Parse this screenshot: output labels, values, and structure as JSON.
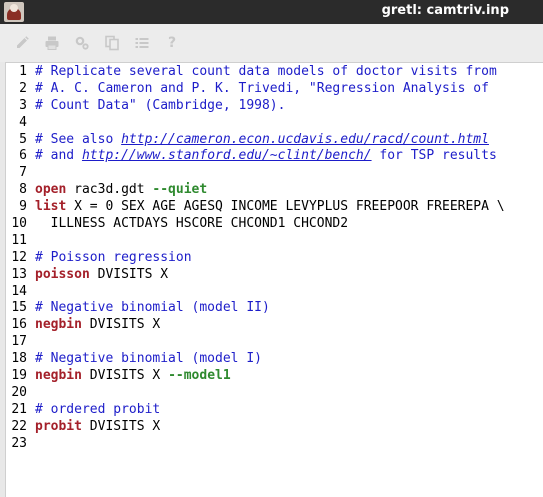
{
  "window": {
    "title": "gretl: camtriv.inp"
  },
  "toolbar": {
    "buttons": [
      {
        "name": "edit-icon"
      },
      {
        "name": "print-icon"
      },
      {
        "name": "settings-icon"
      },
      {
        "name": "copy-icon"
      },
      {
        "name": "list-icon"
      },
      {
        "name": "help-icon",
        "glyph": "?"
      }
    ],
    "icon_color": "#c8c8c8"
  },
  "editor": {
    "colors": {
      "comment": "#1d1dc9",
      "keyword": "#a4202a",
      "option": "#2f8a2f",
      "text": "#000000"
    },
    "lines": [
      {
        "num": "1",
        "seg": [
          {
            "t": "# Replicate several count data models of doctor visits from",
            "c": "cmt"
          }
        ]
      },
      {
        "num": "2",
        "seg": [
          {
            "t": "# A. C. Cameron and P. K. Trivedi, \"Regression Analysis of",
            "c": "cmt"
          }
        ]
      },
      {
        "num": "3",
        "seg": [
          {
            "t": "# Count Data\" (Cambridge, 1998).",
            "c": "cmt"
          }
        ]
      },
      {
        "num": "4",
        "seg": []
      },
      {
        "num": "5",
        "seg": [
          {
            "t": "# See also ",
            "c": "cmt"
          },
          {
            "t": "http://cameron.econ.ucdavis.edu/racd/count.html",
            "c": "link"
          }
        ]
      },
      {
        "num": "6",
        "seg": [
          {
            "t": "# and ",
            "c": "cmt"
          },
          {
            "t": "http://www.stanford.edu/~clint/bench/",
            "c": "link"
          },
          {
            "t": " for TSP results",
            "c": "cmt"
          }
        ]
      },
      {
        "num": "7",
        "seg": []
      },
      {
        "num": "8",
        "seg": [
          {
            "t": "open",
            "c": "kw"
          },
          {
            "t": " rac3d.gdt ",
            "c": "plain"
          },
          {
            "t": "--quiet",
            "c": "opt"
          }
        ]
      },
      {
        "num": "9",
        "seg": [
          {
            "t": "list",
            "c": "kw"
          },
          {
            "t": " X = 0 SEX AGE AGESQ INCOME LEVYPLUS FREEPOOR FREEREPA \\",
            "c": "plain"
          }
        ]
      },
      {
        "num": "10",
        "seg": [
          {
            "t": "  ILLNESS ACTDAYS HSCORE CHCOND1 CHCOND2",
            "c": "plain"
          }
        ]
      },
      {
        "num": "11",
        "seg": []
      },
      {
        "num": "12",
        "seg": [
          {
            "t": "# Poisson regression",
            "c": "cmt"
          }
        ]
      },
      {
        "num": "13",
        "seg": [
          {
            "t": "poisson",
            "c": "kw"
          },
          {
            "t": " DVISITS X",
            "c": "plain"
          }
        ]
      },
      {
        "num": "14",
        "seg": []
      },
      {
        "num": "15",
        "seg": [
          {
            "t": "# Negative binomial (model II)",
            "c": "cmt"
          }
        ]
      },
      {
        "num": "16",
        "seg": [
          {
            "t": "negbin",
            "c": "kw"
          },
          {
            "t": " DVISITS X",
            "c": "plain"
          }
        ]
      },
      {
        "num": "17",
        "seg": []
      },
      {
        "num": "18",
        "seg": [
          {
            "t": "# Negative binomial (model I)",
            "c": "cmt"
          }
        ]
      },
      {
        "num": "19",
        "seg": [
          {
            "t": "negbin",
            "c": "kw"
          },
          {
            "t": " DVISITS X ",
            "c": "plain"
          },
          {
            "t": "--model1",
            "c": "opt"
          }
        ]
      },
      {
        "num": "20",
        "seg": []
      },
      {
        "num": "21",
        "seg": [
          {
            "t": "# ordered probit",
            "c": "cmt"
          }
        ]
      },
      {
        "num": "22",
        "seg": [
          {
            "t": "probit",
            "c": "kw"
          },
          {
            "t": " DVISITS X",
            "c": "plain"
          }
        ]
      },
      {
        "num": "23",
        "seg": []
      }
    ]
  }
}
